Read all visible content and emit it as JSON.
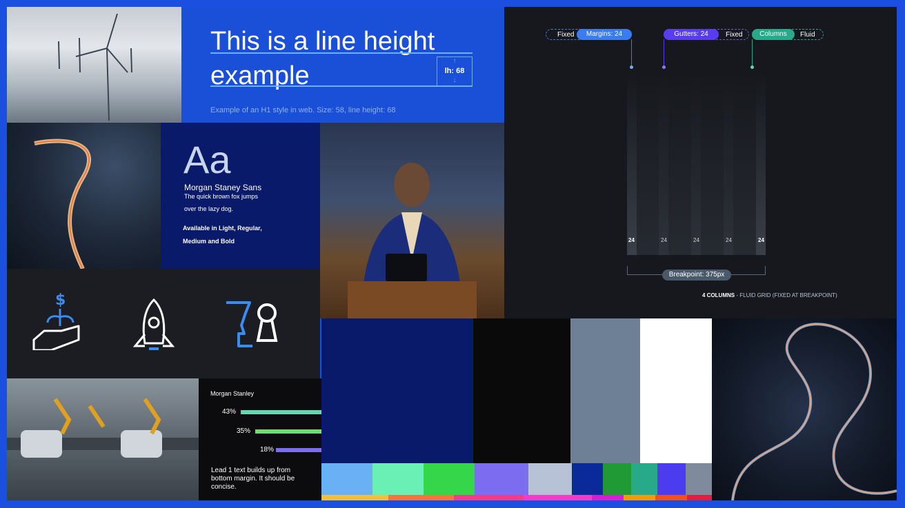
{
  "headline": {
    "line1": "This is a line height",
    "line2": "example",
    "lh_badge": "lh: 68",
    "caption": "Example of an H1 style in web. Size: 58, line height: 68"
  },
  "typeface": {
    "sample": "Aa",
    "name": "Morgan Staney Sans",
    "pangram1": "The quick brown fox jumps",
    "pangram2": "over the lazy dog.",
    "weights1": "Available in Light, Regular,",
    "weights2": "Medium and Bold"
  },
  "grid": {
    "pill1_left": "Fixed",
    "pill1_right": "Margins: 24",
    "pill2_left": "Gutters: 24",
    "pill2_right": "Fixed",
    "pill3_left": "Columns",
    "pill3_right": "Fluid",
    "labels": [
      "24",
      "24",
      "24",
      "24",
      "24"
    ],
    "breakpoint": "Breakpoint: 375px",
    "footer_bold": "4 COLUMNS",
    "footer_rest": " - FLUID GRID (FIXED AT BREAKPOINT)"
  },
  "icons": [
    "money-plant-hand-icon",
    "rocket-icon",
    "head-keyhole-icon"
  ],
  "stats": {
    "brand": "Morgan Stanley",
    "bars": [
      {
        "label": "43%",
        "value": 43,
        "color": "#5fd8b6"
      },
      {
        "label": "35%",
        "value": 35,
        "color": "#6ee06e"
      },
      {
        "label": "18%",
        "value": 18,
        "color": "#7b6cf0"
      }
    ],
    "lead": "Lead 1 text builds up from bottom margin. It should be concise."
  },
  "colors": {
    "frame": "#1a4fe0",
    "navy": "#0a1a6a",
    "black": "#0a0a0a",
    "slate": "#6e8096",
    "white": "#ffffff",
    "row2": [
      "#6ab0f5",
      "#6af0b5",
      "#36d64a",
      "#7b6cf0",
      "#b8c2d6",
      "#0b2a9a",
      "#1f9a35",
      "#27a98a",
      "#4b3cf0",
      "#7f8a9c"
    ],
    "row3": [
      "#f0c040",
      "#f07840",
      "#f03c8c",
      "#f03cc8",
      "#d020d0",
      "#f09a10",
      "#f05020",
      "#e02040",
      "#d03090",
      "#c020a0"
    ]
  }
}
